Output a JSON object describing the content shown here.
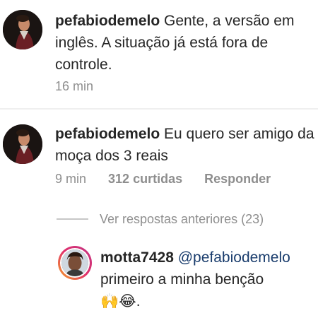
{
  "comments": [
    {
      "username": "pefabiodemelo",
      "text": " Gente, a versão em inglês. A situação já está fora de controle.",
      "time": "16 min"
    },
    {
      "username": "pefabiodemelo",
      "text": " Eu quero ser amigo da moça dos 3 reais",
      "time": "9 min",
      "likes": "312 curtidas",
      "reply": "Responder"
    }
  ],
  "view_previous": "Ver respostas anteriores (23)",
  "reply": {
    "username": "motta7428",
    "mention": "@pefabiodemelo",
    "text": "primeiro a minha benção",
    "emoji": "🙌😂",
    "suffix": "."
  },
  "colors": {
    "text": "#262626",
    "meta": "#8e8e8e",
    "mention": "#1a3d6d",
    "divider": "#efefef"
  }
}
